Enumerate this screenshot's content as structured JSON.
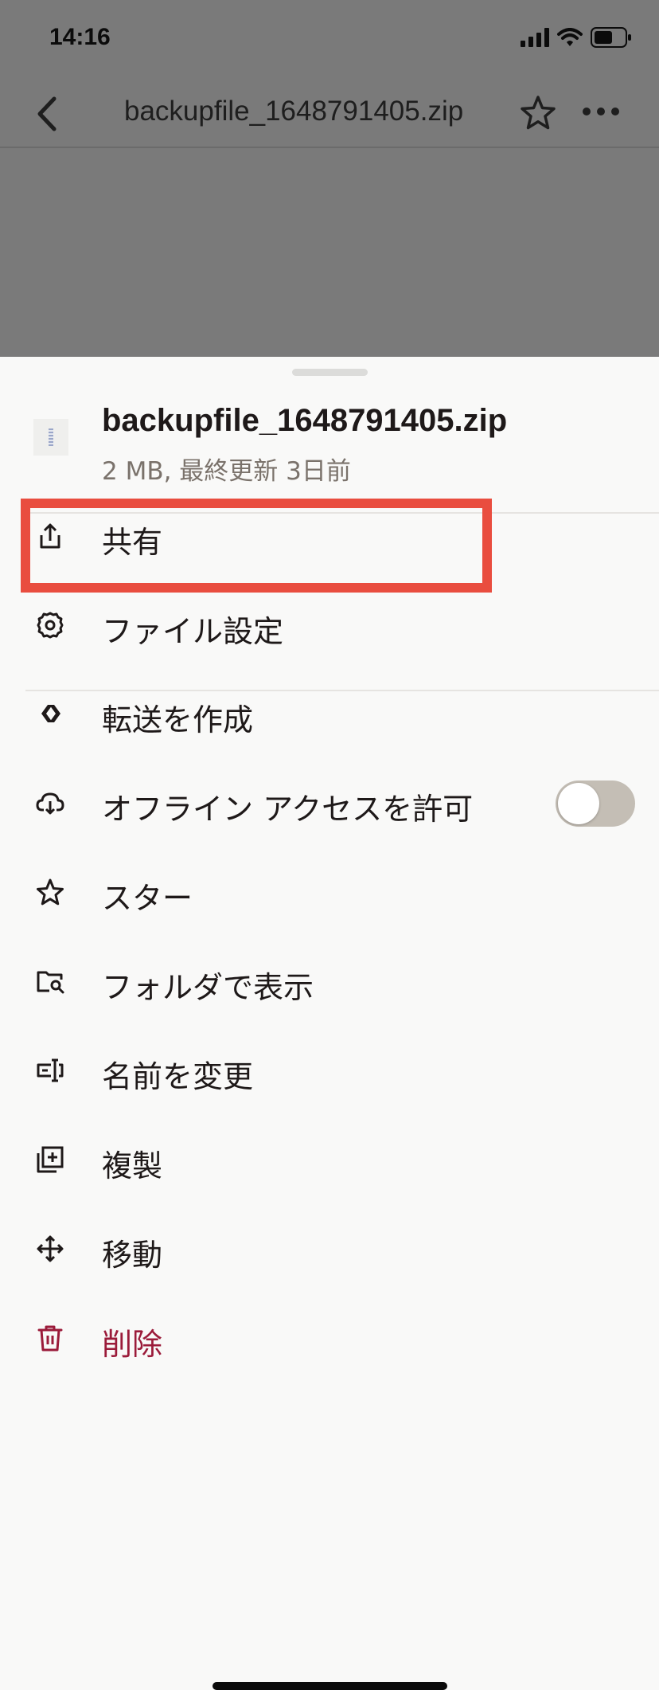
{
  "status_bar": {
    "time": "14:16",
    "icons": [
      "signal-icon",
      "wifi-icon",
      "battery-icon"
    ]
  },
  "nav": {
    "title": "backupfile_1648791405.zip",
    "icons": [
      "back-chevron-icon",
      "star-icon",
      "more-icon"
    ]
  },
  "sheet": {
    "file_name": "backupfile_1648791405.zip",
    "file_meta": "2 MB, 最終更新 3日前",
    "menu": [
      {
        "label": "共有",
        "icon": "share-icon"
      },
      {
        "label": "ファイル設定",
        "icon": "gear-icon"
      },
      {
        "label": "転送を作成",
        "icon": "transfer-icon"
      },
      {
        "label": "オフライン アクセスを許可",
        "icon": "cloud-download-icon",
        "toggle": false
      },
      {
        "label": "スター",
        "icon": "star-icon"
      },
      {
        "label": "フォルダで表示",
        "icon": "folder-search-icon"
      },
      {
        "label": "名前を変更",
        "icon": "rename-icon"
      },
      {
        "label": "複製",
        "icon": "duplicate-icon"
      },
      {
        "label": "移動",
        "icon": "move-icon"
      },
      {
        "label": "削除",
        "icon": "trash-icon"
      }
    ]
  },
  "colors": {
    "highlight": "#e94d3f",
    "danger": "#9b1b3a",
    "overlay": "#7a7a7a",
    "toggle_off": "#c4beb5"
  }
}
